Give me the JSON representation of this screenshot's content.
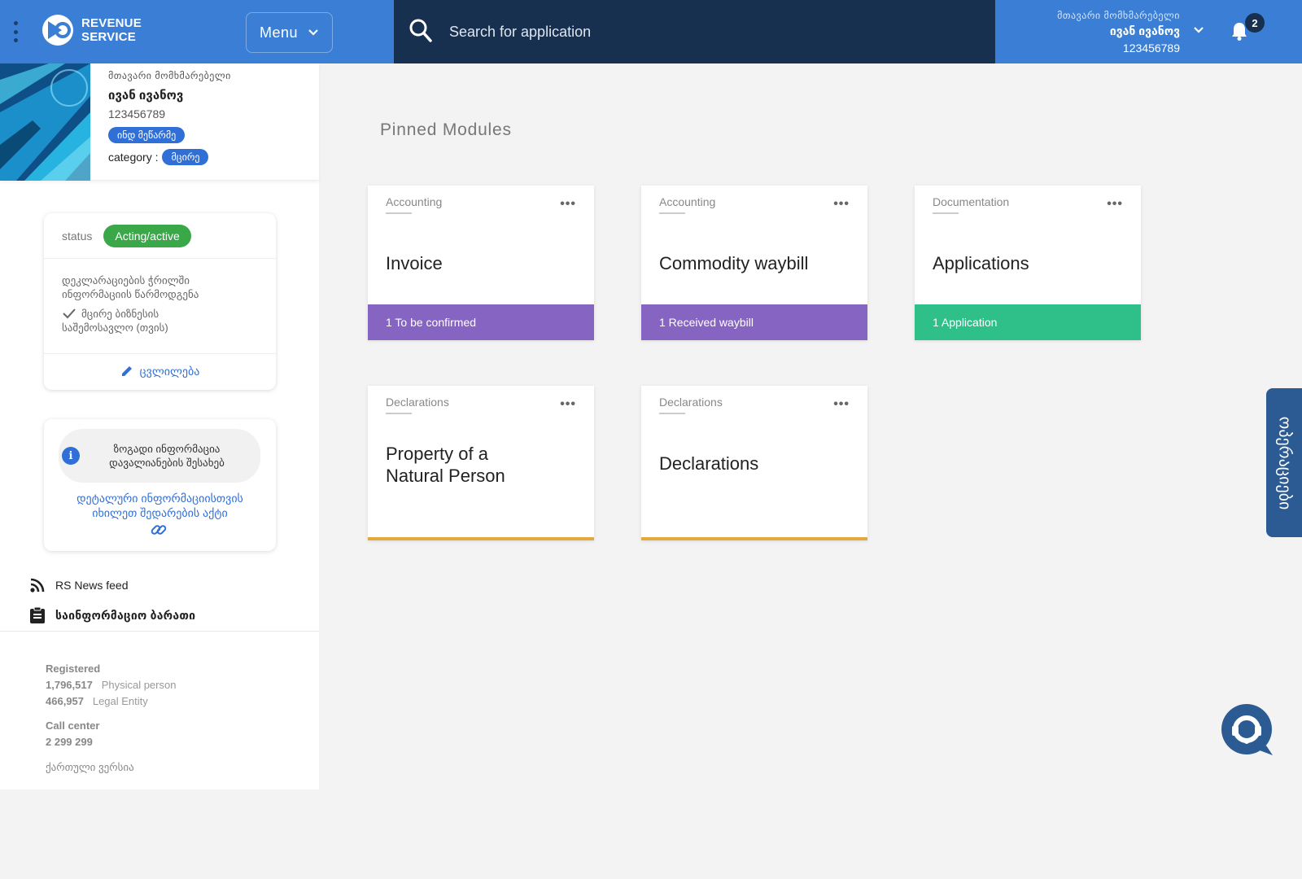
{
  "header": {
    "logo_line1": "REVENUE",
    "logo_line2": "SERVICE",
    "menu_label": "Menu",
    "search_placeholder": "Search for application",
    "user_role": "მთავარი მომხმარებელი",
    "user_name": "ივან ივანოვ",
    "user_id": "123456789",
    "notification_count": "2"
  },
  "sidebar": {
    "profile": {
      "role": "მთავარი მომხმარებელი",
      "name": "ივან ივანოვ",
      "id": "123456789",
      "pill": "ინდ მეწარმე",
      "category_label": "category :",
      "category_value": "მცირე"
    },
    "status_card": {
      "label": "status",
      "badge": "Acting/active",
      "line1": "დეკლარაციების ჭრილში",
      "line2": "ინფორმაციის წარმოდგენა",
      "check_line1": "მცირე ბიზნესის",
      "check_line2": "საშემოსავლო (თვის)",
      "edit_label": "ცვლილება"
    },
    "info_card": {
      "bubble_line1": "ზოგადი ინფორმაცია",
      "bubble_line2": "დავალიანების შესახებ",
      "link_line1": "დეტალური ინფორმაციისთვის",
      "link_line2": "იხილეთ შედარების აქტი"
    },
    "nav": {
      "news": "RS News feed",
      "info_board": "საინფორმაციო ბარათი"
    },
    "stats": {
      "registered_label": "Registered",
      "physical_count": "1,796,517",
      "physical_label": "Physical person",
      "legal_count": "466,957",
      "legal_label": "Legal Entity",
      "call_center_label": "Call center",
      "call_center_number": "2 299 299"
    },
    "language_link": "ქართული ვერსია"
  },
  "main": {
    "title": "Pinned Modules",
    "modules": [
      {
        "category": "Accounting",
        "title": "Invoice",
        "footer": "1 To be confirmed",
        "footer_color": "#8664c2"
      },
      {
        "category": "Accounting",
        "title": "Commodity waybill",
        "footer": "1 Received waybill",
        "footer_color": "#8664c2"
      },
      {
        "category": "Documentation",
        "title": "Applications",
        "footer": "1 Application",
        "footer_color": "#2fc08a"
      },
      {
        "category": "Declarations",
        "title": "Property of a Natural Person",
        "footer": "",
        "footer_color": "#e3a93d"
      },
      {
        "category": "Declarations",
        "title": "Declarations",
        "footer": "",
        "footer_color": "#e3a93d"
      }
    ],
    "more_label": "•••"
  },
  "side_tab": {
    "label": "ოპერაციები"
  },
  "icons": [
    "kebab-icon",
    "logo-icon",
    "chevron-down-icon",
    "search-icon",
    "bell-icon",
    "check-icon",
    "pencil-icon",
    "info-icon",
    "link-icon",
    "rss-icon",
    "clipboard-icon",
    "chat-support-icon"
  ],
  "colors": {
    "header_blue": "#3a7fd5",
    "search_navy": "#17304f",
    "accent": "#2f6fd6",
    "active_green": "#3aa749"
  }
}
